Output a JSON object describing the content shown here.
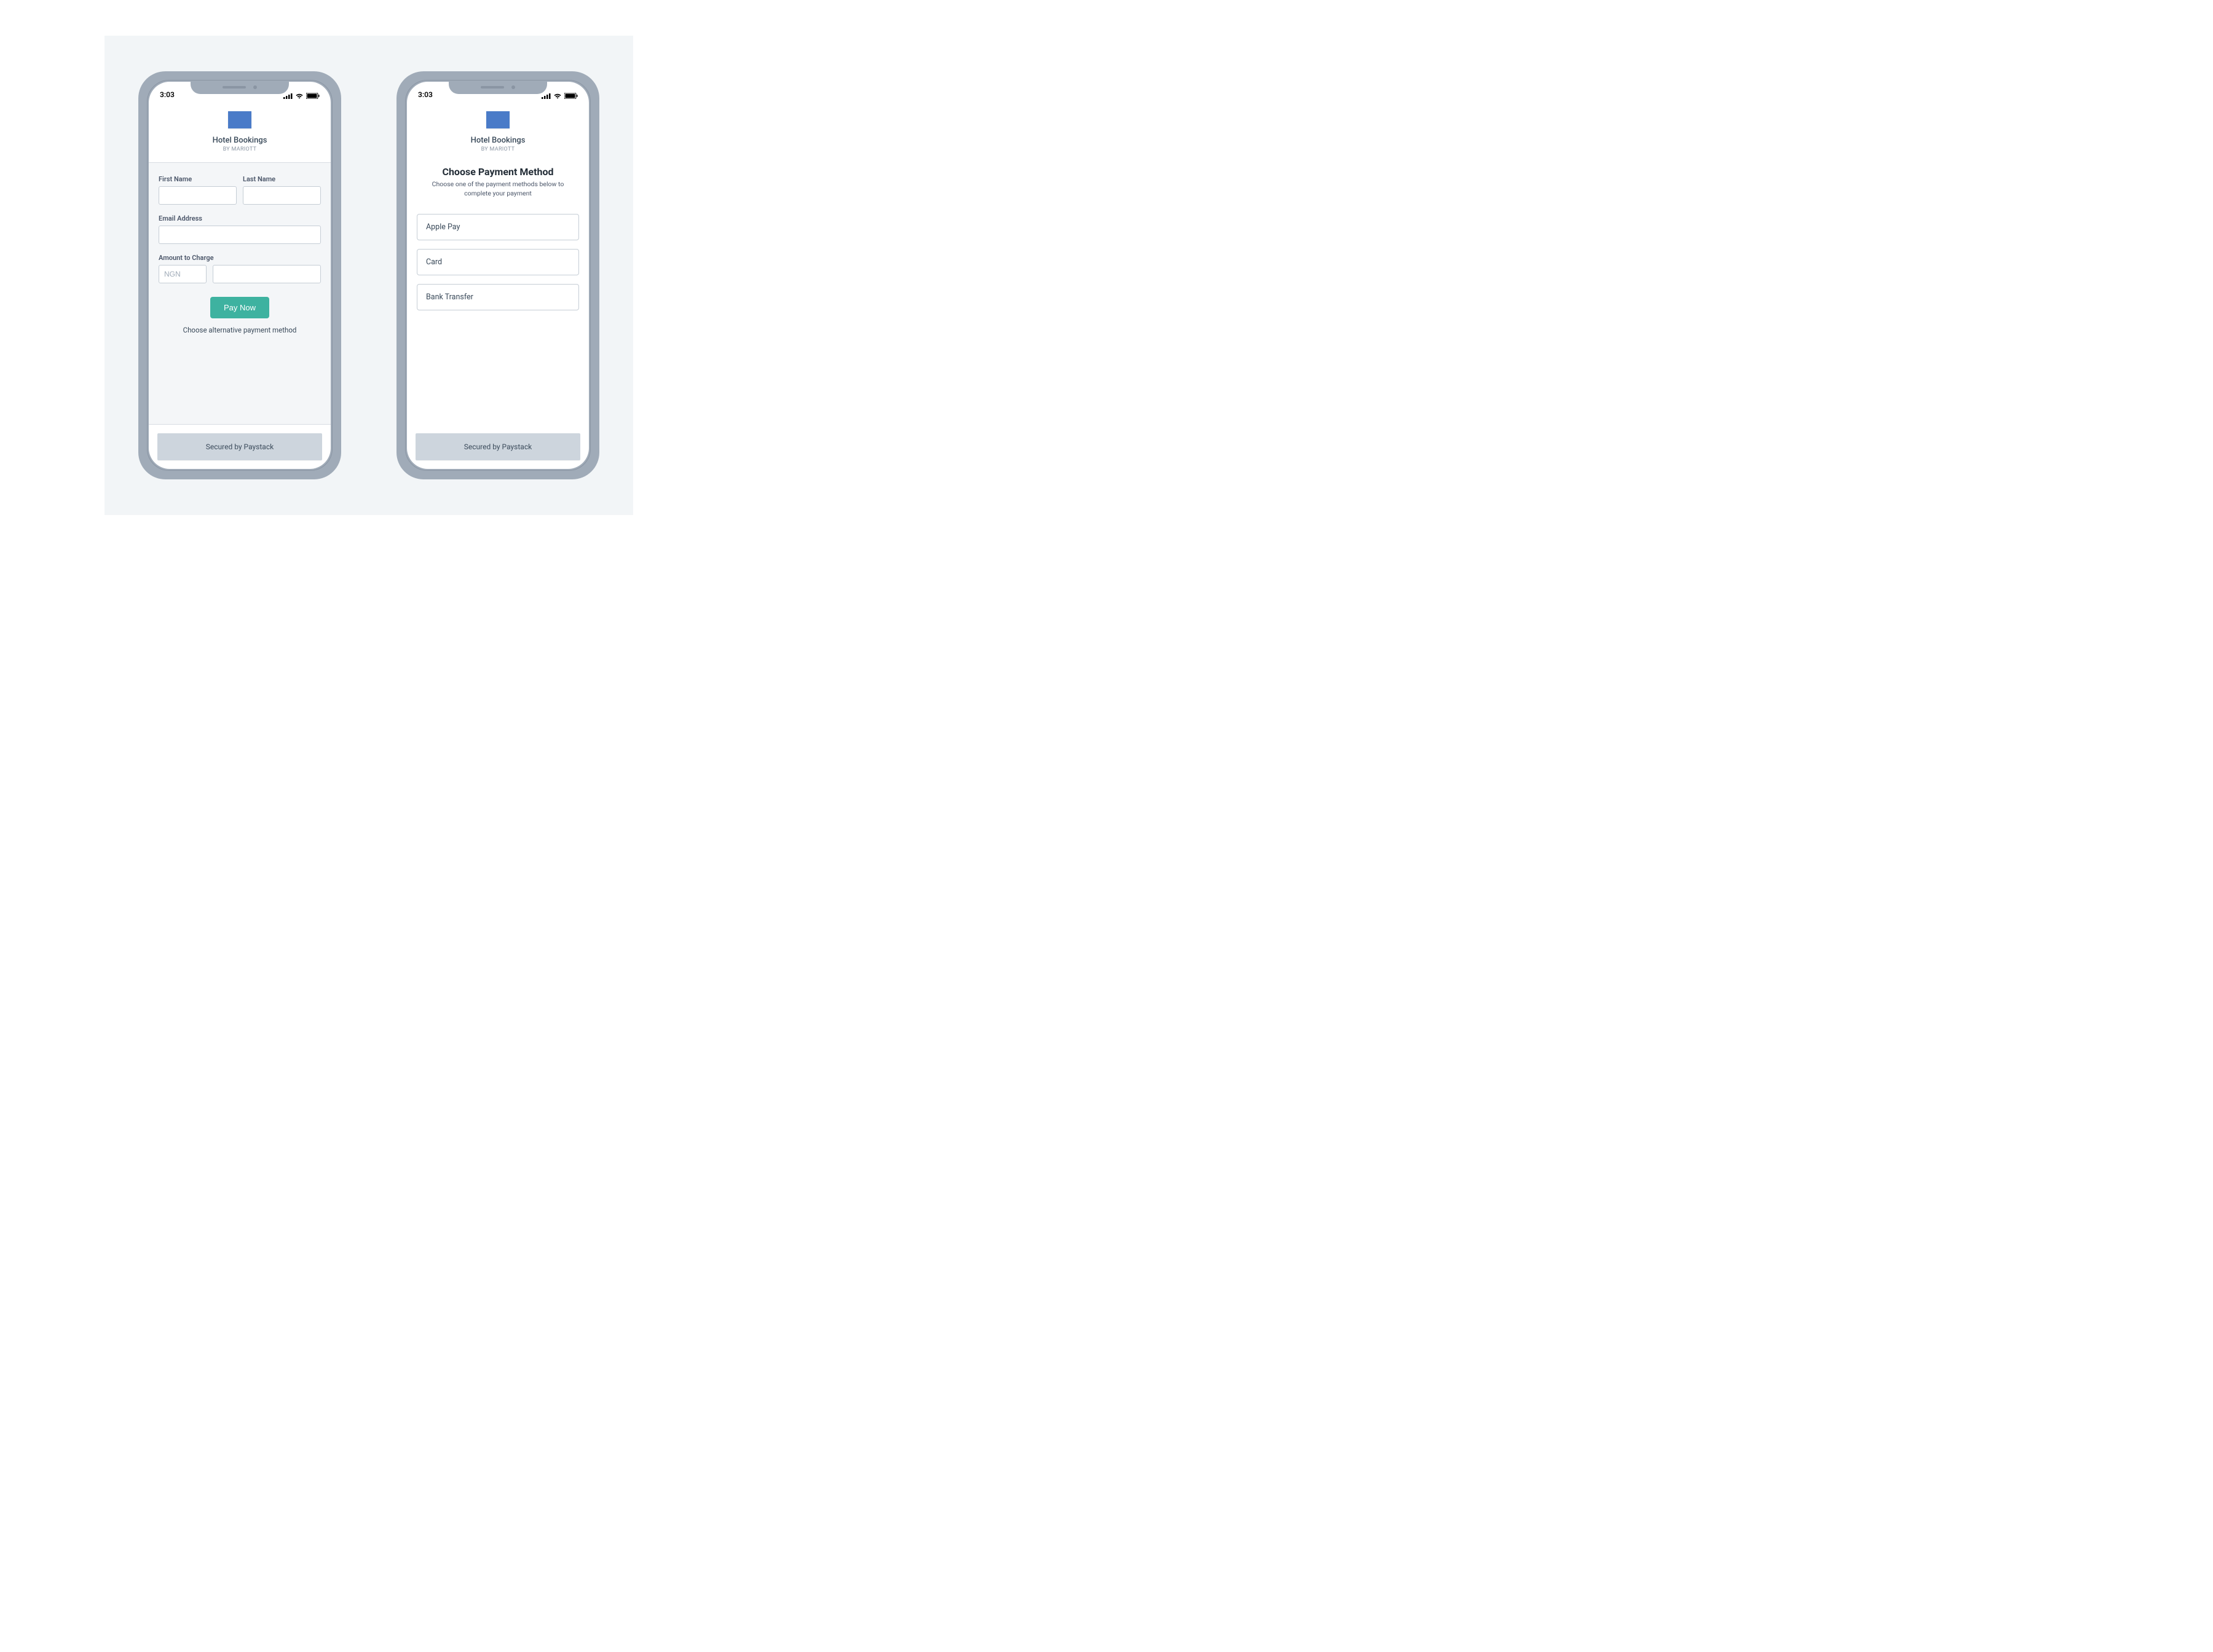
{
  "status": {
    "time": "3:03"
  },
  "header": {
    "title": "Hotel Bookings",
    "subtitle": "BY MARIOTT"
  },
  "form": {
    "first_name_label": "First Name",
    "last_name_label": "Last Name",
    "email_label": "Email Address",
    "amount_label": "Amount to Charge",
    "currency_placeholder": "NGN",
    "pay_button": "Pay Now",
    "alt_link": "Choose alternative payment method"
  },
  "footer": {
    "secured": "Secured by Paystack"
  },
  "screen2": {
    "title": "Choose Payment Method",
    "subtitle": "Choose one of the payment methods below to complete your payment",
    "options": [
      {
        "label": "Apple Pay"
      },
      {
        "label": "Card"
      },
      {
        "label": "Bank Transfer"
      }
    ]
  }
}
